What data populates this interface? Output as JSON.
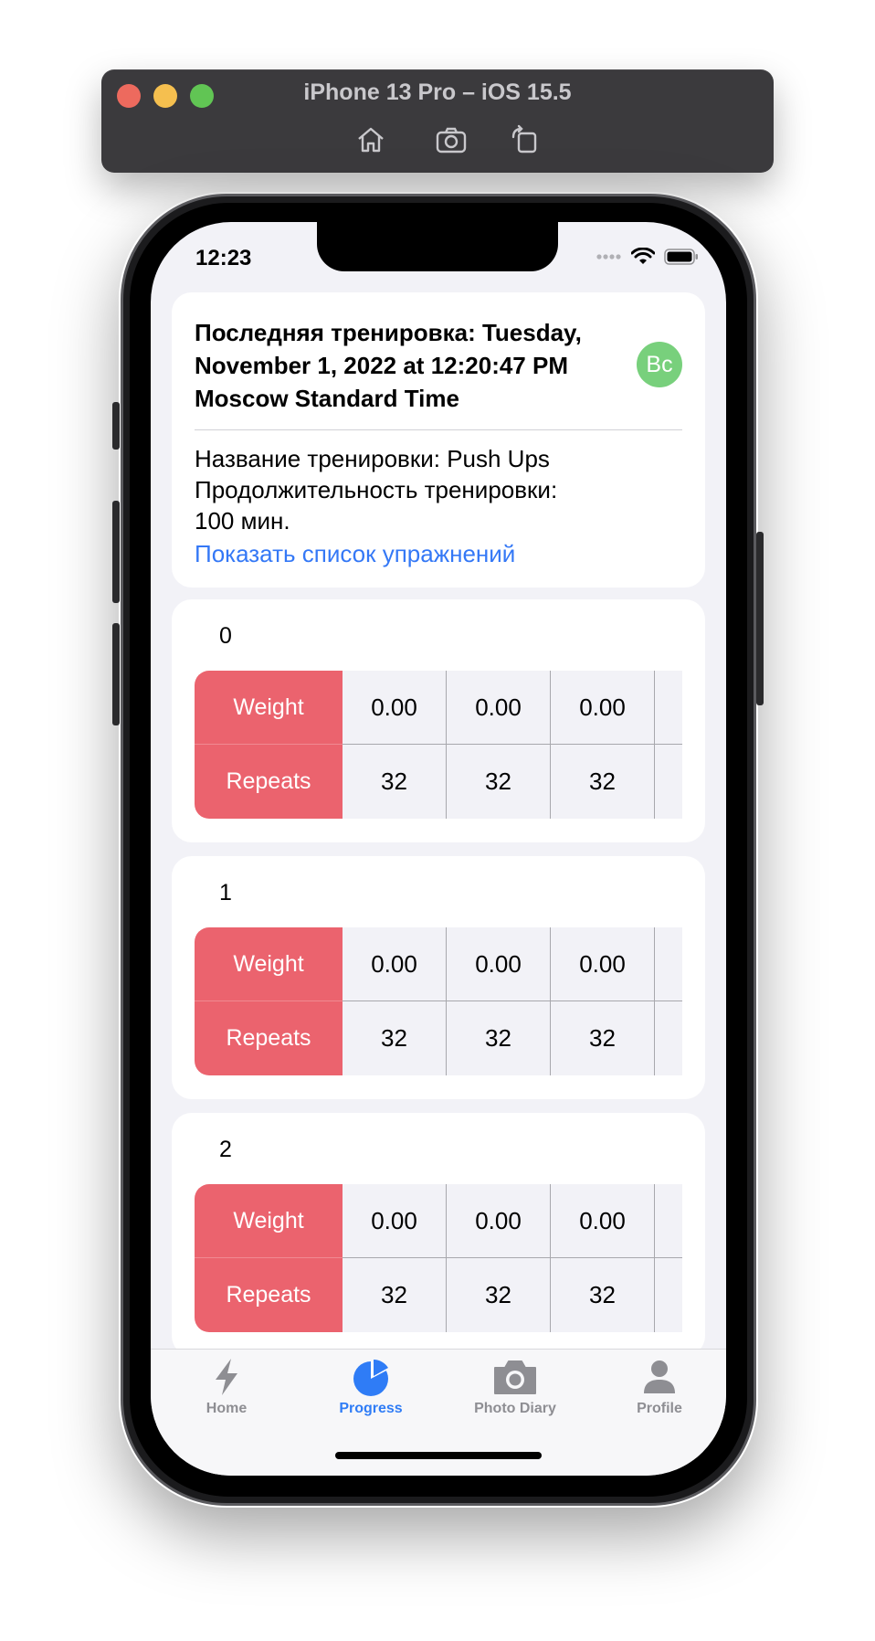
{
  "simulator": {
    "title": "iPhone 13 Pro – iOS 15.5",
    "buttons": [
      "home-icon",
      "screenshot-icon",
      "rotate-icon"
    ]
  },
  "status_bar": {
    "time": "12:23"
  },
  "workout": {
    "title": "Последняя тренировка: Tuesday, November 1, 2022 at 12:20:47 PM Moscow Standard Time",
    "avatar_initials": "Вс",
    "avatar_color": "#78d07c",
    "name_line": "Название тренировки: Push Ups",
    "duration_line_1": "Продолжительность тренировки:",
    "duration_line_2": "100 мин.",
    "show_exercises_link": "Показать список упражнений"
  },
  "exercises": [
    {
      "title": "0",
      "weight_label": "Weight",
      "repeats_label": "Repeats",
      "weights": [
        "0.00",
        "0.00",
        "0.00"
      ],
      "repeats": [
        "32",
        "32",
        "32"
      ]
    },
    {
      "title": "1",
      "weight_label": "Weight",
      "repeats_label": "Repeats",
      "weights": [
        "0.00",
        "0.00",
        "0.00"
      ],
      "repeats": [
        "32",
        "32",
        "32"
      ]
    },
    {
      "title": "2",
      "weight_label": "Weight",
      "repeats_label": "Repeats",
      "weights": [
        "0.00",
        "0.00",
        "0.00"
      ],
      "repeats": [
        "32",
        "32",
        "32"
      ]
    }
  ],
  "tab_bar": {
    "tabs": [
      {
        "label": "Home",
        "icon": "bolt-icon",
        "active": false
      },
      {
        "label": "Progress",
        "icon": "pie-chart-icon",
        "active": true
      },
      {
        "label": "Photo Diary",
        "icon": "camera-icon",
        "active": false
      },
      {
        "label": "Profile",
        "icon": "person-icon",
        "active": false
      }
    ]
  },
  "colors": {
    "accent": "#2f7cf6",
    "table_label_bg": "#eb636e",
    "link": "#3478f6"
  }
}
